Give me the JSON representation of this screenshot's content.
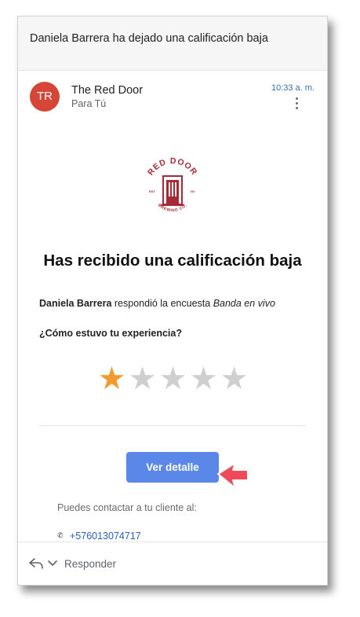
{
  "email": {
    "subject": "Daniela Barrera ha dejado una calificación baja",
    "sender": {
      "avatar_initials": "TR",
      "name": "The Red Door",
      "recipient_line": "Para Tú",
      "time": "10:33 a. m."
    },
    "body": {
      "logo": {
        "top_text": "RED DOOR",
        "left_text": "EST",
        "right_text": "NV",
        "bottom_text": "BREWING CO."
      },
      "headline": "Has recibido una calificación baja",
      "survey_line": {
        "customer_name": "Daniela Barrera",
        "action_text": " respondió la encuesta ",
        "survey_name": "Banda en vivo"
      },
      "question": "¿Cómo estuvo tu experiencia?",
      "rating": {
        "value": 1,
        "max": 5,
        "filled_color": "#f29a2e",
        "empty_color": "#cfcfcf"
      },
      "cta_label": "Ver detalle",
      "contact_prompt": "Puedes contactar a tu cliente al:",
      "contact_phone": "+576013074717"
    },
    "reply_bar": {
      "reply_label": "Responder"
    }
  },
  "colors": {
    "avatar_bg": "#d64637",
    "cta_bg": "#5b87e8",
    "link": "#2a5fb0",
    "brand_red": "#a52a35",
    "cursor": "#ef4a5a"
  }
}
